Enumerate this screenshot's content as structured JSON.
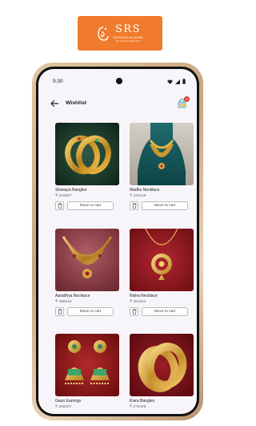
{
  "brand": {
    "name": "SRS",
    "subtitle": "SWARNA BHAVAN",
    "tagline": "Your trusted jewellers since",
    "color": "#f07b2c"
  },
  "status_bar": {
    "time": "9:30"
  },
  "app_bar": {
    "title": "Wishlist",
    "cart_count": "4"
  },
  "labels": {
    "move_to_cart": "Move to cart"
  },
  "products": [
    {
      "name": "Shanaya Bangles",
      "price": "₹ 245987"
    },
    {
      "name": "Madhu Necklace",
      "price": "₹ 420419"
    },
    {
      "name": "Aaradhya Necklace",
      "price": "₹ 485019"
    },
    {
      "name": "Nisha Necklace",
      "price": "₹ 261944"
    },
    {
      "name": "Gauri Earrings",
      "price": "₹ 289307"
    },
    {
      "name": "Kiara Bangles",
      "price": "₹ 275425"
    }
  ]
}
